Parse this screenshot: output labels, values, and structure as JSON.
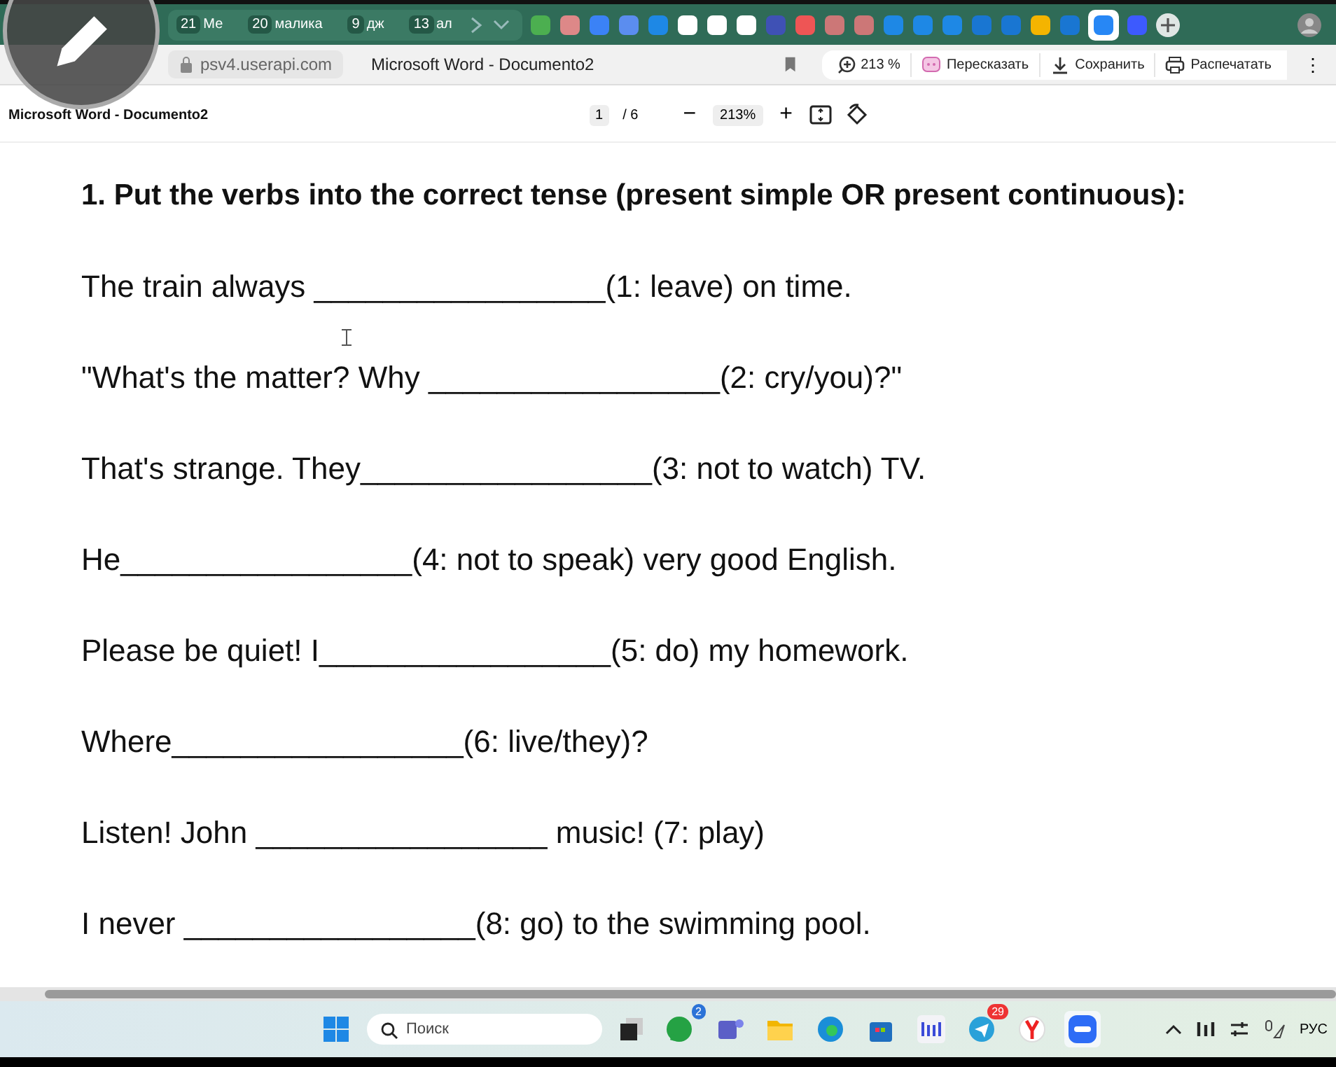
{
  "browser_tabs": [
    {
      "count": "21",
      "label": "Ме"
    },
    {
      "count": "20",
      "label": "малика"
    },
    {
      "count": "9",
      "label": "дж"
    },
    {
      "count": "13",
      "label": "ал"
    }
  ],
  "address_bar": {
    "url": "psv4.userapi.com",
    "page_title": "Microsoft Word - Documento2",
    "zoom": "213 %",
    "actions": [
      "Пересказать",
      "Сохранить",
      "Распечатать"
    ],
    "more": "⋮"
  },
  "pdf_toolbar": {
    "title": "Microsoft Word - Documento2",
    "page": "1",
    "pages": "/ 6",
    "zoom_out": "−",
    "zoom": "213%",
    "zoom_in": "+"
  },
  "document": {
    "heading": "1. Put the verbs into the correct tense (present simple OR present continuous):",
    "lines": [
      "The train always _________________(1: leave) on time.",
      "\"What's the matter? Why _________________(2: cry/you)?\"",
      "That's strange. They_________________(3: not to watch) TV.",
      "He_________________(4: not to speak) very good English.",
      "Please be quiet! I_________________(5: do) my homework.",
      "Where_________________(6: live/they)?",
      "Listen! John _________________ music! (7: play)",
      "I never _________________(8: go) to the swimming pool."
    ]
  },
  "taskbar": {
    "search_placeholder": "Поиск",
    "badges": [
      "2",
      "29"
    ],
    "language": "РУС"
  }
}
